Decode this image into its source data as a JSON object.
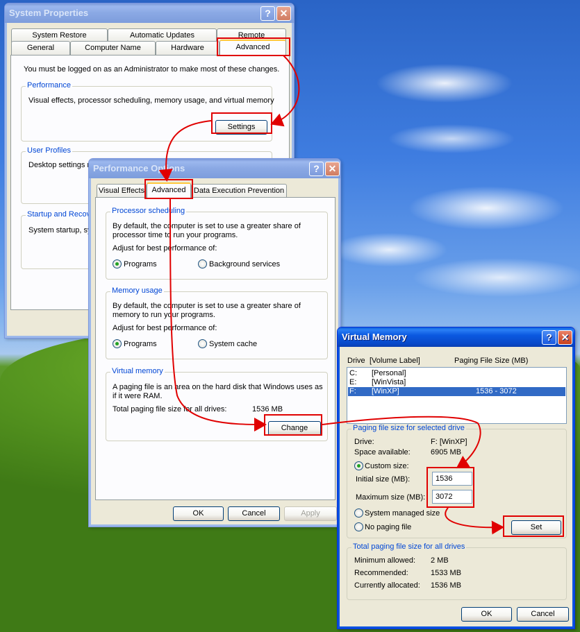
{
  "sys": {
    "title": "System Properties",
    "help": "?",
    "close": "✕",
    "tabs_back": [
      "System Restore",
      "Automatic Updates",
      "Remote"
    ],
    "tabs_front": [
      "General",
      "Computer Name",
      "Hardware",
      "Advanced"
    ],
    "admin_note": "You must be logged on as an Administrator to make most of these changes.",
    "perf_title": "Performance",
    "perf_desc": "Visual effects, processor scheduling, memory usage, and virtual memory",
    "settings": "Settings",
    "profiles_title": "User Profiles",
    "profiles_desc": "Desktop settings re",
    "startup_title": "Startup and Recov",
    "startup_desc": "System startup, sys"
  },
  "perf": {
    "title": "Performance Options",
    "help": "?",
    "close": "✕",
    "tabs": [
      "Visual Effects",
      "Advanced",
      "Data Execution Prevention"
    ],
    "proc_title": "Processor scheduling",
    "proc_desc1": "By default, the computer is set to use a greater share of",
    "proc_desc2": "processor time to run your programs.",
    "adjust": "Adjust for best performance of:",
    "programs": "Programs",
    "background": "Background services",
    "mem_title": "Memory usage",
    "mem_desc1": "By default, the computer is set to use a greater share of",
    "mem_desc2": "memory to run your programs.",
    "system_cache": "System cache",
    "vm_title": "Virtual memory",
    "vm_desc1": "A paging file is an area on the hard disk that Windows uses as",
    "vm_desc2": "if it were RAM.",
    "total_label": "Total paging file size for all drives:",
    "total_value": "1536 MB",
    "change": "Change",
    "ok": "OK",
    "cancel": "Cancel",
    "apply": "Apply"
  },
  "vm": {
    "title": "Virtual Memory",
    "help": "?",
    "close": "✕",
    "col_drive": "Drive",
    "col_label": "[Volume Label]",
    "col_size": "Paging File Size (MB)",
    "drives": [
      {
        "drive": "C:",
        "label": "[Personal]",
        "size": ""
      },
      {
        "drive": "E:",
        "label": "[WinVista]",
        "size": ""
      },
      {
        "drive": "F:",
        "label": "[WinXP]",
        "size": "1536 - 3072"
      }
    ],
    "sel_title": "Paging file size for selected drive",
    "drive_label": "Drive:",
    "drive_value": "F:  [WinXP]",
    "space_label": "Space available:",
    "space_value": "6905 MB",
    "custom": "Custom size:",
    "initial_label": "Initial size (MB):",
    "initial_value": "1536",
    "max_label": "Maximum size (MB):",
    "max_value": "3072",
    "system_managed": "System managed size",
    "no_paging": "No paging file",
    "set": "Set",
    "total_title": "Total paging file size for all drives",
    "min_label": "Minimum allowed:",
    "min_value": "2 MB",
    "rec_label": "Recommended:",
    "rec_value": "1533 MB",
    "cur_label": "Currently allocated:",
    "cur_value": "1536 MB",
    "ok": "OK",
    "cancel": "Cancel"
  },
  "colors": {
    "highlight": "#e00000",
    "group_title": "#0046d5",
    "selection": "#316ac5"
  }
}
